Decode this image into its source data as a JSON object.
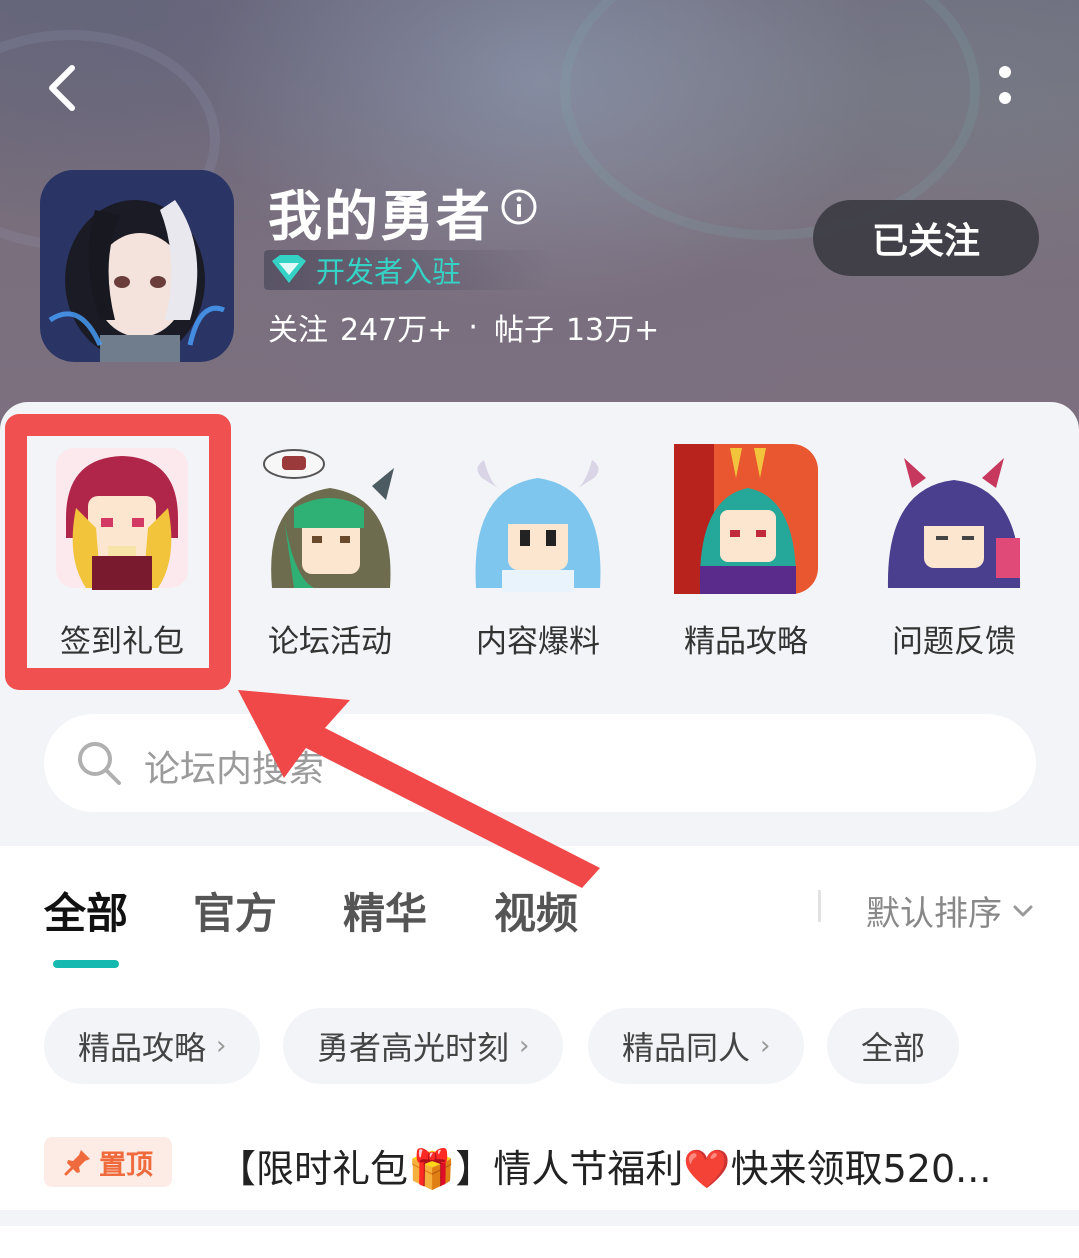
{
  "forum": {
    "title": "我的勇者",
    "developer_badge": "开发者入驻",
    "stats": {
      "follow_label": "关注",
      "follow_count": "247万+",
      "separator": "·",
      "posts_label": "帖子",
      "posts_count": "13万+"
    },
    "follow_button": "已关注"
  },
  "entries": [
    {
      "label": "签到礼包",
      "highlighted": true
    },
    {
      "label": "论坛活动"
    },
    {
      "label": "内容爆料"
    },
    {
      "label": "精品攻略"
    },
    {
      "label": "问题反馈"
    }
  ],
  "search": {
    "placeholder": "论坛内搜索"
  },
  "tabs": [
    {
      "label": "全部",
      "active": true
    },
    {
      "label": "官方"
    },
    {
      "label": "精华"
    },
    {
      "label": "视频"
    }
  ],
  "sort": {
    "label": "默认排序"
  },
  "chips": [
    {
      "label": "精品攻略",
      "chevron": "›"
    },
    {
      "label": "勇者高光时刻",
      "chevron": "›"
    },
    {
      "label": "精品同人",
      "chevron": "›"
    },
    {
      "label": "全部"
    }
  ],
  "pinned_post": {
    "tag": "置顶",
    "title": "【限时礼包🎁】情人节福利❤️快来领取520..."
  },
  "colors": {
    "accent": "#16b9b0",
    "developer_badge": "#35d3c6",
    "highlight": "#f05050",
    "pin_tag_text": "#ef6a3c"
  },
  "icons": {
    "back": "chevron-left-icon",
    "more": "more-vertical-icon",
    "info": "info-icon",
    "diamond": "diamond-icon",
    "search": "search-icon",
    "sort": "chevron-down-icon",
    "pin": "pin-icon"
  }
}
